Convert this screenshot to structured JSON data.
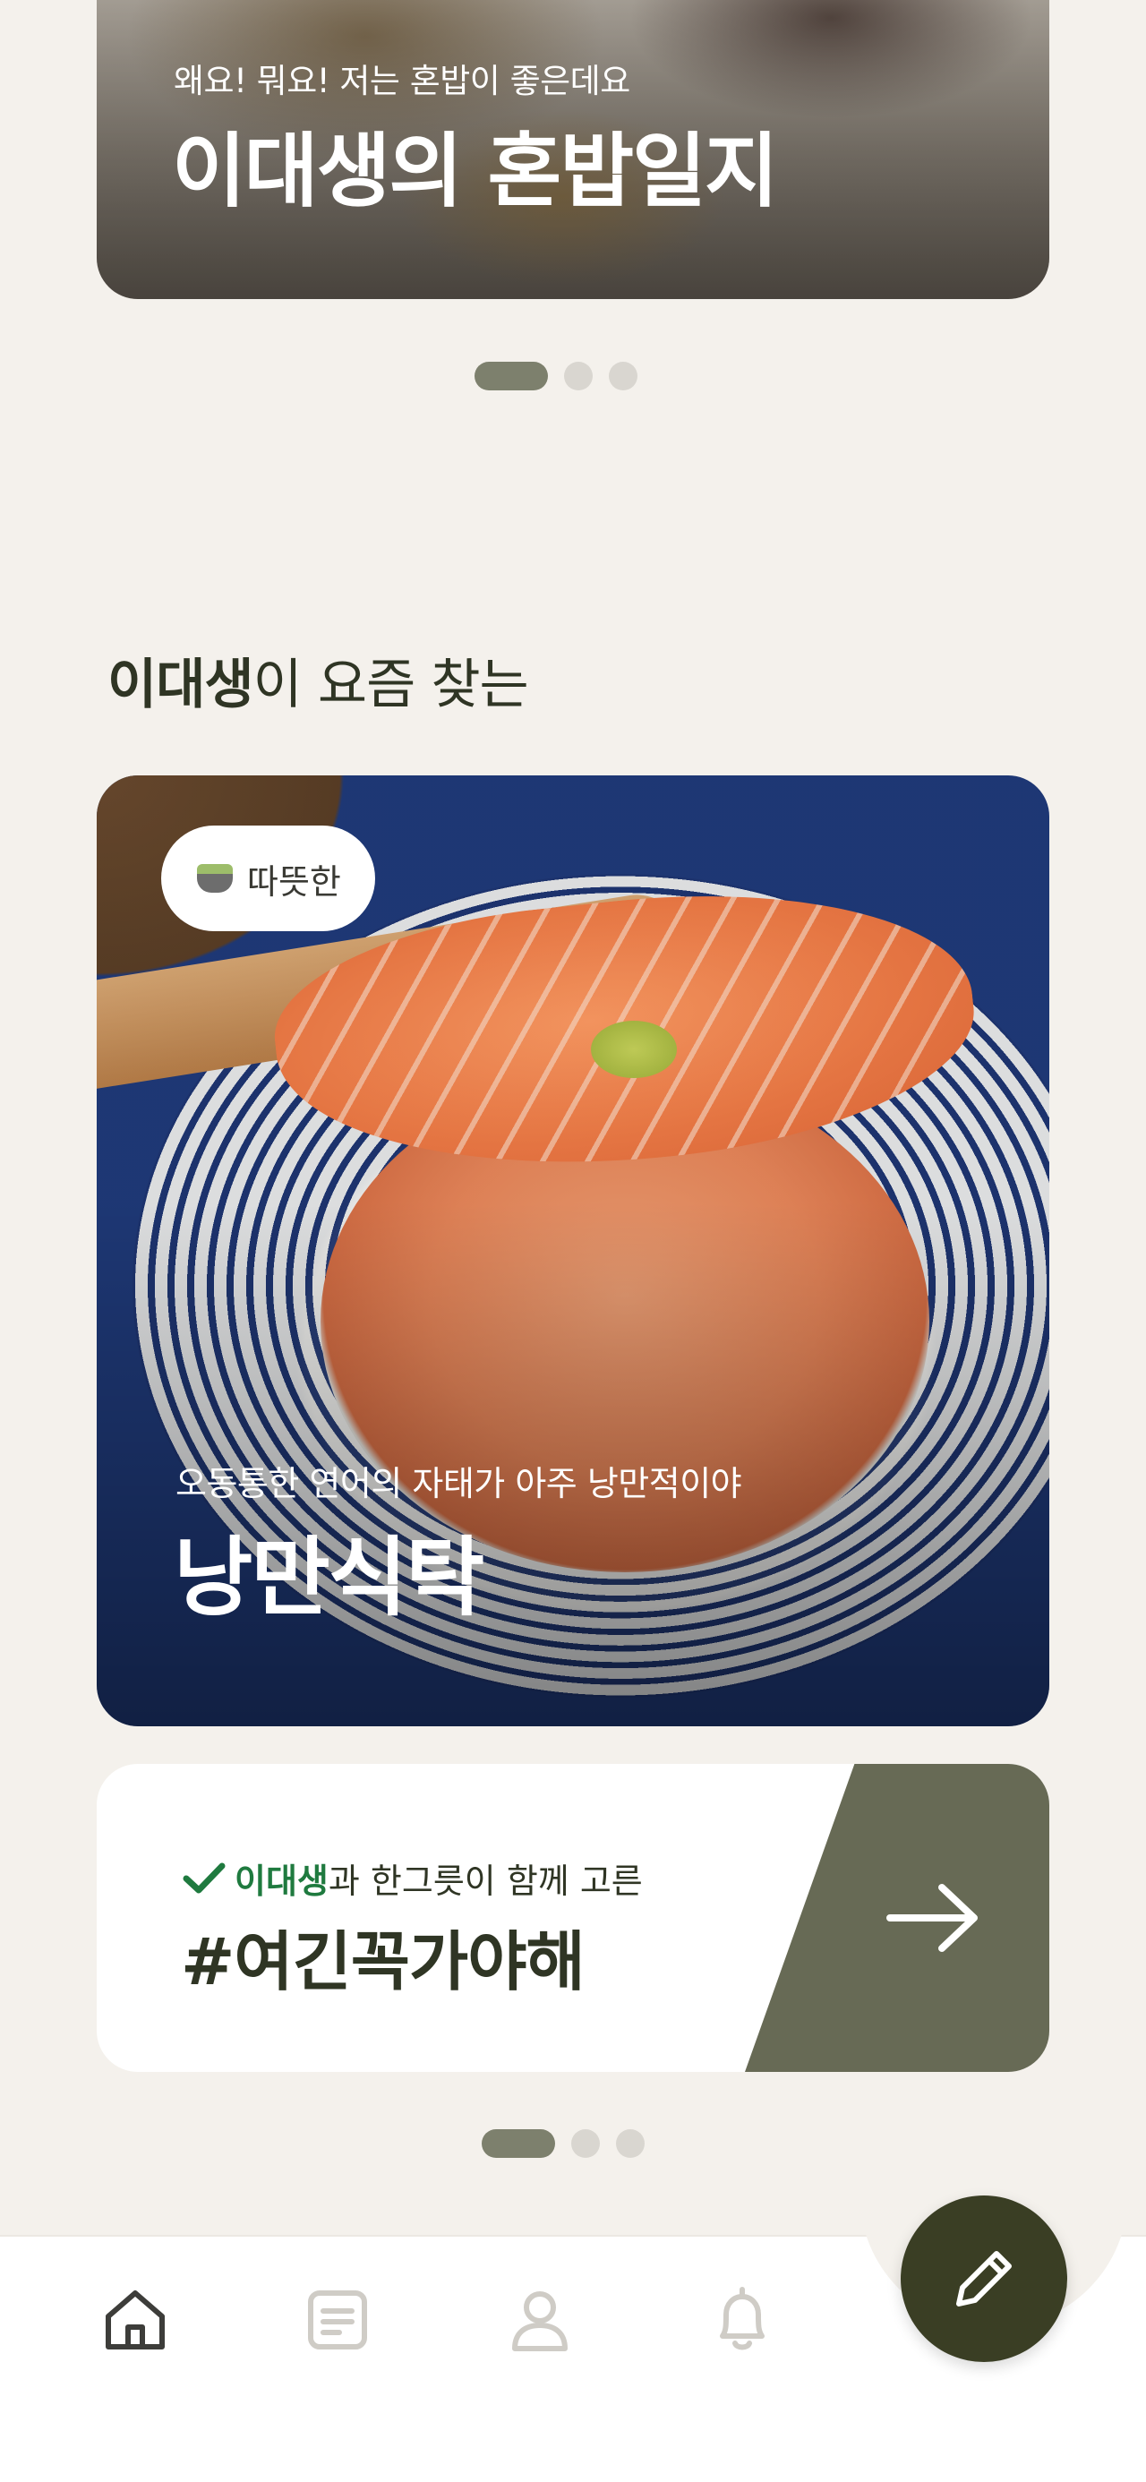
{
  "banner": {
    "subtitle": "왜요! 뭐요! 저는 혼밥이 좋은데요",
    "title": "이대생의 혼밥일지"
  },
  "section": {
    "heading_bold": "이대생",
    "heading_rest": "이 요즘 찾는"
  },
  "feature": {
    "chip_label": "따뜻한",
    "chip_icon": "tea-cup-icon",
    "subtitle": "오동통한 연어의 자태가 아주 낭만적이야",
    "title": "낭만식탁"
  },
  "recommendation": {
    "sub_highlight": "이대생",
    "sub_rest": "과 한그릇이 함께 고른",
    "title": "#여긴꼭가야해",
    "accent_color": "#676a55",
    "highlight_color": "#1f7a3f"
  },
  "nav": {
    "items": [
      {
        "icon": "home-icon",
        "active": true
      },
      {
        "icon": "document-icon",
        "active": false
      },
      {
        "icon": "profile-icon",
        "active": false
      },
      {
        "icon": "bell-icon",
        "active": false
      }
    ],
    "fab_icon": "pencil-icon",
    "fab_color": "#3a3e24"
  }
}
